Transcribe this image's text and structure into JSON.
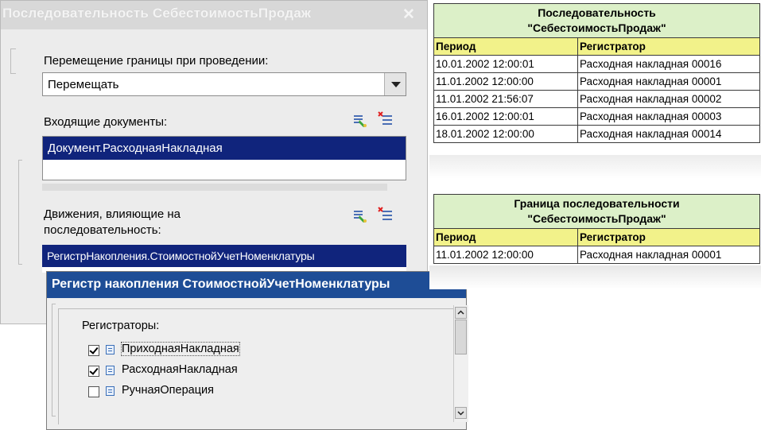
{
  "dialog1": {
    "title": "Последовательность СебестоимостьПродаж",
    "close_glyph": "✕",
    "move_border_label": "Перемещение границы при проведении:",
    "move_border_value": "Перемещать",
    "incoming_label": "Входящие документы:",
    "incoming_items": [
      "Документ.РасходнаяНакладная"
    ],
    "movements_label_line1": "Движения, влияющие на",
    "movements_label_line2": "последовательность:",
    "movements_items": [
      "РегистрНакопления.СтоимостнойУчетНоменклатуры"
    ],
    "icons": [
      "add-icon",
      "remove-icon"
    ]
  },
  "dialog2": {
    "title": "Регистр накопления СтоимостнойУчетНоменклатуры",
    "registrators_label": "Регистраторы:",
    "items": [
      {
        "label": "ПриходнаяНакладная",
        "checked": true
      },
      {
        "label": "РасходнаяНакладная",
        "checked": true
      },
      {
        "label": "РучнаяОперация",
        "checked": false
      }
    ]
  },
  "table1": {
    "caption_line1": "Последовательность",
    "caption_line2": "\"СебестоимостьПродаж\"",
    "headers": [
      "Период",
      "Регистратор"
    ],
    "rows": [
      [
        "10.01.2002 12:00:01",
        "Расходная накладная 00016"
      ],
      [
        "11.01.2002 12:00:00",
        "Расходная накладная 00001"
      ],
      [
        "11.01.2002 21:56:07",
        "Расходная накладная 00002"
      ],
      [
        "16.01.2002 12:00:01",
        "Расходная накладная 00003"
      ],
      [
        "18.01.2002 12:00:00",
        "Расходная накладная 00014"
      ]
    ]
  },
  "table2": {
    "caption_line1": "Граница последовательности",
    "caption_line2": "\"СебестоимостьПродаж\"",
    "headers": [
      "Период",
      "Регистратор"
    ],
    "rows": [
      [
        "11.01.2002 12:00:00",
        "Расходная накладная 00001"
      ]
    ]
  }
}
